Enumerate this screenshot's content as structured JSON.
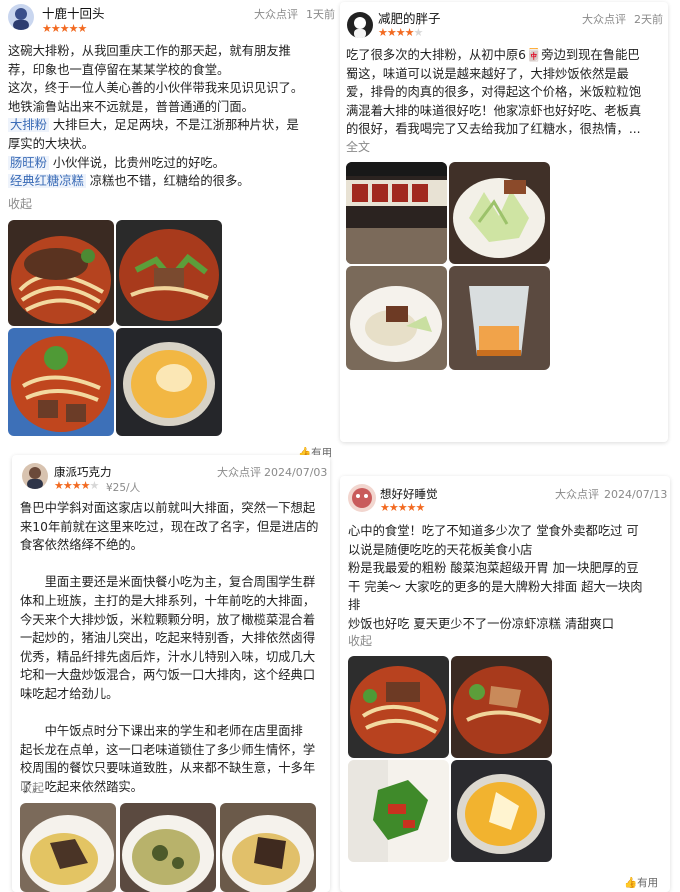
{
  "reviews": [
    {
      "user": "十鹿十回头",
      "rating": 5,
      "stars": [
        "★",
        "★",
        "★",
        "★",
        "★"
      ],
      "source": "大众点评",
      "time": "1天前",
      "lines": [
        "这碗大排粉，从我回重庆工作的那天起，就有朋友推",
        "荐，印象也一直停留在某某学校的食堂。",
        "这次，终于一位人美心善的小伙伴带我来见识见识了。",
        "地铁渝鲁站出来不远就是，普普通通的门面。"
      ],
      "tagged": [
        {
          "tag": "大排粉",
          "text": " 大排巨大，足足两块，不是江浙那种片状，是"
        },
        {
          "tag": "",
          "text": "厚实的大块状。"
        },
        {
          "tag": "肠旺粉",
          "text": " 小伙伴说，比贵州吃过的好吃。"
        },
        {
          "tag": "经典红糖凉糕",
          "text": " 凉糕也不错，红糖给的很多。"
        }
      ],
      "collapse": "收起",
      "photos": [
        "noodle-with-pork-photo",
        "spicy-noodle-photo",
        "noodle-with-herbs-photo",
        "egg-pudding-photo"
      ]
    },
    {
      "user": "减肥的胖子",
      "rating": 4.5,
      "stars": [
        "★",
        "★",
        "★",
        "★",
        "★"
      ],
      "source": "大众点评",
      "time": "2天前",
      "lines": [
        "吃了很多次的大排粉，从初中原6🀄旁边到现在鲁能巴",
        "蜀这，味道可以说是越来越好了，大排炒饭依然是最",
        "爱，排骨的肉真的很多，对得起这个价格，米饭粒粒饱",
        "满混着大排的味道很好吃！他家凉虾也好好吃、老板真",
        "的很好，看我喝完了又去给我加了红糖水，很热情，..."
      ],
      "expand": "全文",
      "photos": [
        "shop-counter-photo",
        "cabbage-plate-photo",
        "rice-plate-photo",
        "cold-shrimp-cup-photo"
      ]
    },
    {
      "user": "康派巧克力",
      "rating": 4,
      "stars": [
        "★",
        "★",
        "★",
        "★",
        "★"
      ],
      "price": "¥25/人",
      "source": "大众点评",
      "time": "2024/07/03",
      "lines": [
        "鲁巴中学斜对面这家店以前就叫大排面，突然一下想起",
        "来10年前就在这里来吃过，现在改了名字，但是进店的",
        "食客依然络绎不绝的。",
        "",
        "　　里面主要还是米面快餐小吃为主，复合周围学生群",
        "体和上班族，主打的是大排系列，十年前吃的大排面，",
        "今天来个大排炒饭，米粒颗颗分明，放了橄榄菜混合着",
        "一起炒的，猪油儿突出，吃起来特别香，大排依然卤得",
        "优秀，精品纤排先卤后炸，汁水儿特别入味，切成几大",
        "坨和一大盘炒饭混合，两勺饭一口大排肉，这个经典口",
        "味吃起才给劲儿。",
        "",
        "　　中午饭点时分下课出来的学生和老师在店里面排",
        "起长龙在点单，这一口老味道锁住了多少师生情怀，学",
        "校周围的餐饮只要味道致胜，从来都不缺生意，十多年",
        "了，吃起来依然踏实。"
      ],
      "collapse": "收起",
      "photos": [
        "fried-rice-plate-photo",
        "fried-rice-greens-photo",
        "fried-rice-pork-photo"
      ]
    },
    {
      "user": "想好好睡觉",
      "rating": 5,
      "stars": [
        "★",
        "★",
        "★",
        "★",
        "★"
      ],
      "source": "大众点评",
      "time": "2024/07/13",
      "lines": [
        "心中的食堂！吃了不知道多少次了 堂食外卖都吃过 可",
        "以说是随便吃吃的天花板美食小店",
        "粉是我最爱的粗粉 酸菜泡菜超级开胃 加一块肥厚的豆",
        "干 完美～ 大家吃的更多的是大牌粉大排面 超大一块肉",
        "排",
        "炒饭也好吃 夏天更少不了一份凉虾凉糕 清甜爽口"
      ],
      "collapse": "收起",
      "useful": "有用",
      "photos": [
        "noodle-pork-bowl-photo",
        "beef-noodle-photo",
        "stir-fry-veg-photo",
        "egg-custard-photo"
      ]
    }
  ],
  "partial_useful": "有用"
}
